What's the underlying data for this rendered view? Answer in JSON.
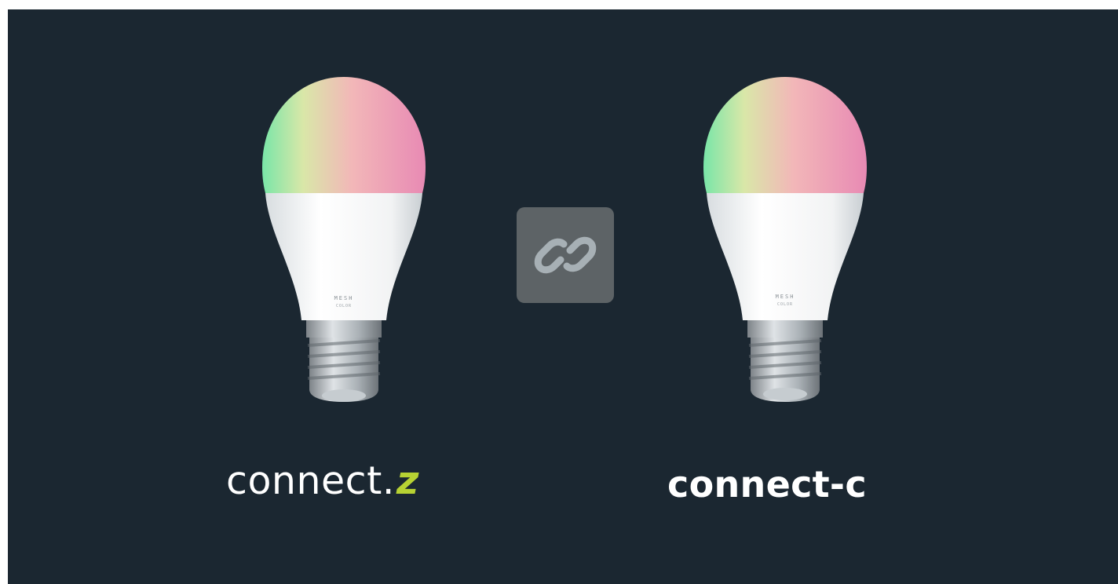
{
  "products": [
    {
      "id": "left",
      "image": "rgb-led-bulb",
      "bulb_label_top": "MESH",
      "bulb_label_bottom": "COLOR",
      "brand_prefix": "connect",
      "brand_separator": ".",
      "brand_mark": "z",
      "brand_mark_color": "#b7d233"
    },
    {
      "id": "right",
      "image": "rgb-led-bulb",
      "bulb_label_top": "MESH",
      "bulb_label_bottom": "COLOR",
      "brand_text": "connect-c"
    }
  ],
  "center_icon": "link-icon",
  "colors": {
    "background": "#1b2731",
    "tile": "#5d6366",
    "icon": "#a7b0b5",
    "text": "#ffffff"
  }
}
